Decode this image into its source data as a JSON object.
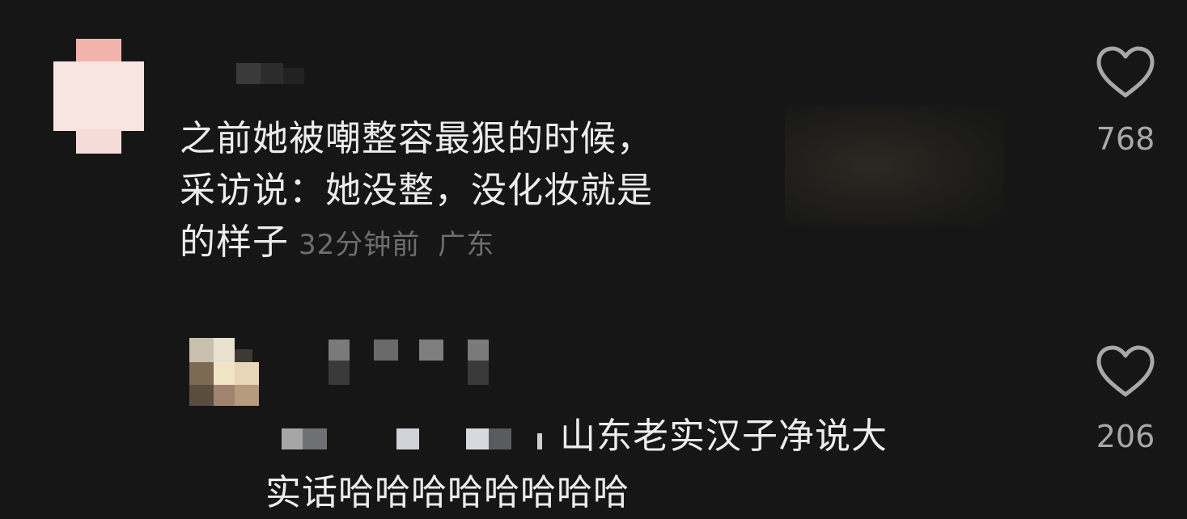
{
  "comments": [
    {
      "lines": [
        "之前她被嘲整容最狠的时候，",
        "采访说：她没整，没化妆就是",
        "的样子"
      ],
      "time": "32分钟前",
      "location": "广东",
      "likes": "768",
      "heart_icon": "heart-outline-icon"
    },
    {
      "lines": [
        "山东老实汉子净说大",
        "实话哈哈哈哈哈哈哈哈"
      ],
      "likes": "206",
      "heart_icon": "heart-outline-icon"
    }
  ],
  "colors": {
    "background": "#161616",
    "text": "#ececec",
    "meta": "#6e6e6e",
    "likes": "#a8a8a8"
  }
}
